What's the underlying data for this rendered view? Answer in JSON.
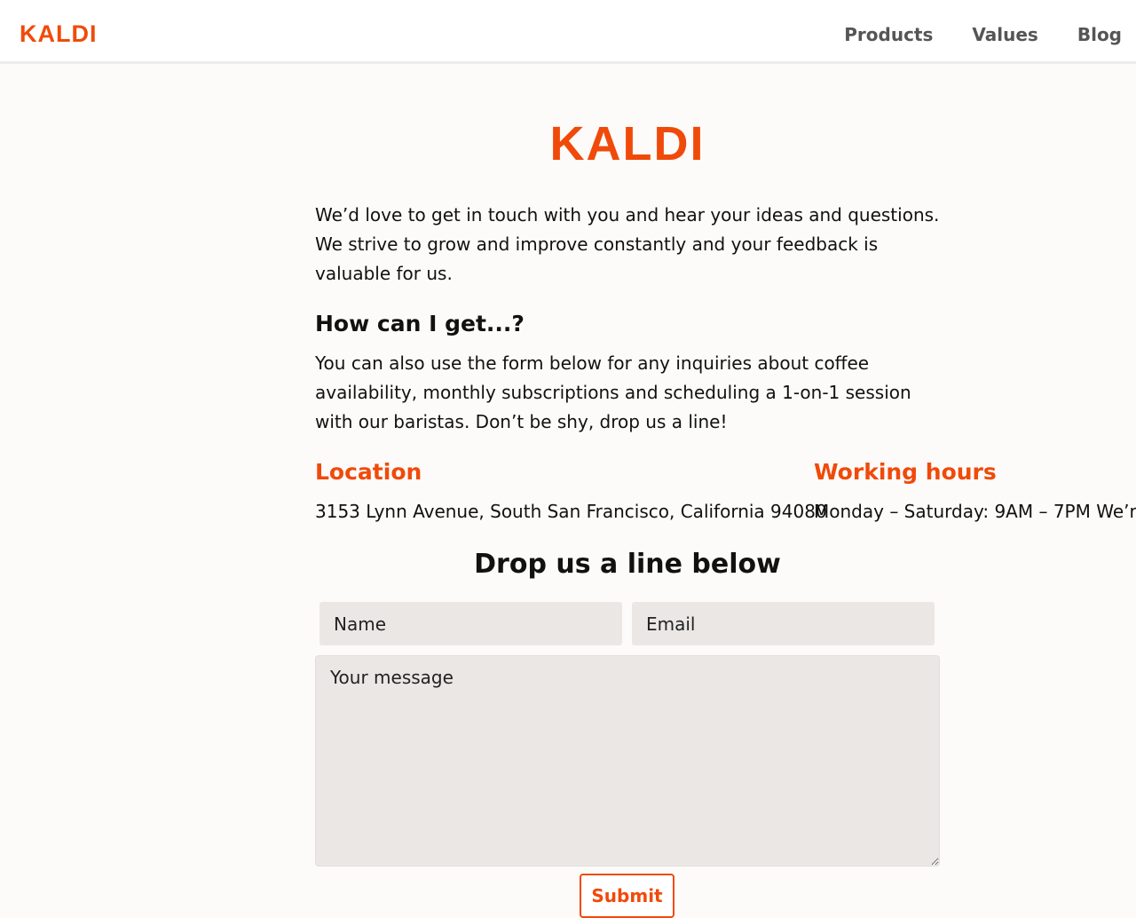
{
  "header": {
    "logo": "KALDI",
    "nav": [
      {
        "label": "Products"
      },
      {
        "label": "Values"
      },
      {
        "label": "Blog"
      }
    ]
  },
  "main": {
    "logo": "KALDI",
    "intro": "We’d love to get in touch with you and hear your ideas and questions. We strive to grow and improve constantly and your feedback is valuable for us.",
    "faq_heading": "How can I get...?",
    "faq_text": "You can also use the form below for any inquiries about coffee availability, monthly subscriptions and scheduling a 1-on-1 session with our baristas. Don’t be shy, drop us a line!",
    "location_heading": "Location",
    "location_text": "3153 Lynn Avenue, South San Francisco, California 94080",
    "hours_heading": "Working hours",
    "hours_text": "Monday – Saturday: 9AM – 7PM We’r"
  },
  "form": {
    "title": "Drop us a line below",
    "name_placeholder": "Name",
    "email_placeholder": "Email",
    "message_placeholder": "Your message",
    "submit_label": "Submit"
  },
  "colors": {
    "accent": "#f04a0a",
    "background": "#fcfbf9",
    "field": "#ebe7e5"
  }
}
